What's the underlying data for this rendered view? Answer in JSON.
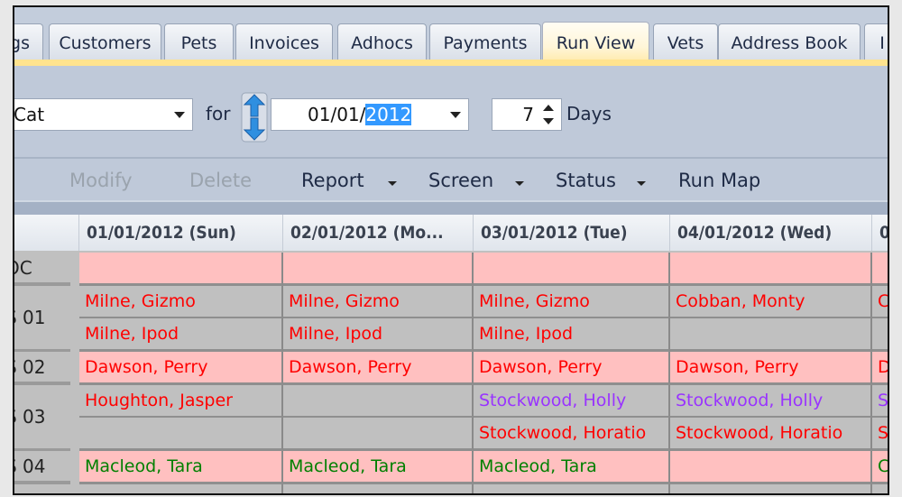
{
  "tabs": [
    {
      "label": "gs"
    },
    {
      "label": "Customers"
    },
    {
      "label": "Pets"
    },
    {
      "label": "Invoices"
    },
    {
      "label": "Adhocs"
    },
    {
      "label": "Payments"
    },
    {
      "label": "Run View",
      "active": true
    },
    {
      "label": "Vets"
    },
    {
      "label": "Address Book"
    },
    {
      "label": "I"
    }
  ],
  "filter": {
    "type_value": "Cat",
    "for_label": "for",
    "date_prefix": "01/01/",
    "date_selected": "2012",
    "days_value": "7",
    "days_label": "Days"
  },
  "toolbar": {
    "modify": "Modify",
    "delete": "Delete",
    "report": "Report",
    "screen": "Screen",
    "status": "Status",
    "run_map": "Run Map"
  },
  "colors": {
    "pink": "#ffc0c0",
    "gray": "#c0c0c0",
    "red": "#ff0000",
    "purple": "#9933ff",
    "green": "#008000",
    "tab_active": "#ffe38e"
  },
  "grid": {
    "columns": [
      "01/01/2012 (Sun)",
      "02/01/2012 (Mo...",
      "03/01/2012 (Tue)",
      "04/01/2012 (Wed)",
      "0"
    ],
    "row_headers": [
      "OC",
      "S 01",
      "S 02",
      "S 03",
      "S 04"
    ],
    "rows": [
      {
        "cells": [
          {
            "t": ""
          },
          {
            "t": ""
          },
          {
            "t": ""
          },
          {
            "t": ""
          },
          {
            "t": ""
          }
        ],
        "bg": "pink"
      },
      {
        "cells": [
          {
            "t": "Milne, Gizmo",
            "c": "red"
          },
          {
            "t": "Milne, Gizmo",
            "c": "red"
          },
          {
            "t": "Milne, Gizmo",
            "c": "red"
          },
          {
            "t": "Cobban, Monty",
            "c": "red"
          },
          {
            "t": "C",
            "c": "red"
          }
        ],
        "bg": "gray"
      },
      {
        "cells": [
          {
            "t": "Milne, Ipod",
            "c": "red"
          },
          {
            "t": "Milne, Ipod",
            "c": "red"
          },
          {
            "t": "Milne, Ipod",
            "c": "red"
          },
          {
            "t": ""
          },
          {
            "t": ""
          }
        ],
        "bg": "gray"
      },
      {
        "cells": [
          {
            "t": "Dawson, Perry",
            "c": "red"
          },
          {
            "t": "Dawson, Perry",
            "c": "red"
          },
          {
            "t": "Dawson, Perry",
            "c": "red"
          },
          {
            "t": "Dawson, Perry",
            "c": "red"
          },
          {
            "t": "D",
            "c": "red"
          }
        ],
        "bg": "pink"
      },
      {
        "cells": [
          {
            "t": "Houghton, Jasper",
            "c": "red"
          },
          {
            "t": ""
          },
          {
            "t": "Stockwood, Holly",
            "c": "purple"
          },
          {
            "t": "Stockwood, Holly",
            "c": "purple"
          },
          {
            "t": "S",
            "c": "purple"
          }
        ],
        "bg": "gray"
      },
      {
        "cells": [
          {
            "t": ""
          },
          {
            "t": ""
          },
          {
            "t": "Stockwood, Horatio",
            "c": "red"
          },
          {
            "t": "Stockwood, Horatio",
            "c": "red"
          },
          {
            "t": "S",
            "c": "red"
          }
        ],
        "bg": "gray"
      },
      {
        "cells": [
          {
            "t": "Macleod, Tara",
            "c": "green"
          },
          {
            "t": "Macleod, Tara",
            "c": "green"
          },
          {
            "t": "Macleod, Tara",
            "c": "green"
          },
          {
            "t": ""
          },
          {
            "t": "C",
            "c": "green"
          }
        ],
        "bg": "pink"
      }
    ]
  }
}
